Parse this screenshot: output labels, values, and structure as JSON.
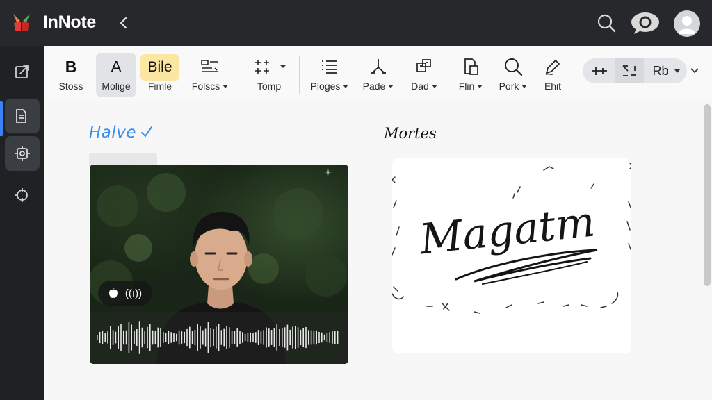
{
  "app": {
    "title": "InNote",
    "logo_icon": "innote-logo-icon",
    "accent_color": "#3b82f6"
  },
  "topbar": {
    "back_icon": "chevron-left-icon",
    "search_icon": "search-icon",
    "chat_icon": "chat-bubble-icon",
    "avatar_icon": "user-avatar-icon"
  },
  "rail": {
    "items": [
      {
        "name": "export",
        "icon": "export-icon"
      },
      {
        "name": "notes",
        "icon": "notes-icon",
        "active": true
      },
      {
        "name": "settings",
        "icon": "gear-icon"
      },
      {
        "name": "sync",
        "icon": "sync-icon"
      }
    ]
  },
  "ribbon": {
    "tools": [
      {
        "label": "Stoss",
        "glyph": "B"
      },
      {
        "label": "Molige",
        "glyph": "A"
      },
      {
        "label": "Fimle",
        "glyph": "Bile"
      },
      {
        "label": "Folscs"
      },
      {
        "label": "Tomp"
      },
      {
        "label": "Ploges"
      },
      {
        "label": "Pade"
      },
      {
        "label": "Dad"
      },
      {
        "label": "Flin"
      },
      {
        "label": "Pork"
      },
      {
        "label": "Ehit"
      }
    ],
    "pill": {
      "label": "Rb"
    }
  },
  "content": {
    "left_heading": "Halve",
    "right_heading": "Mortes",
    "audio_chip_label": "((ı))",
    "signature_text": "Magatm",
    "highlight_color": "#fbe7a1",
    "heading_color": "#3b8ee8"
  }
}
